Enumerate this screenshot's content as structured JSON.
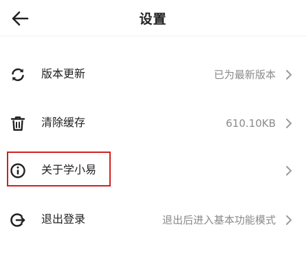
{
  "header": {
    "title": "设置",
    "back_icon": "arrow-left-icon"
  },
  "settings": [
    {
      "label": "版本更新",
      "value": "已为最新版本",
      "icon": "refresh-icon"
    },
    {
      "label": "清除缓存",
      "value": "610.10KB",
      "icon": "trash-icon"
    },
    {
      "label": "关于学小易",
      "value": "",
      "icon": "info-icon"
    },
    {
      "label": "退出登录",
      "value": "退出后进入基本功能模式",
      "icon": "logout-icon"
    }
  ],
  "highlight": {
    "target": "关于学小易",
    "color": "#d01f1f"
  },
  "colors": {
    "text_primary": "#222222",
    "text_secondary": "#8a8a8a",
    "chevron": "#9a9a9a"
  }
}
